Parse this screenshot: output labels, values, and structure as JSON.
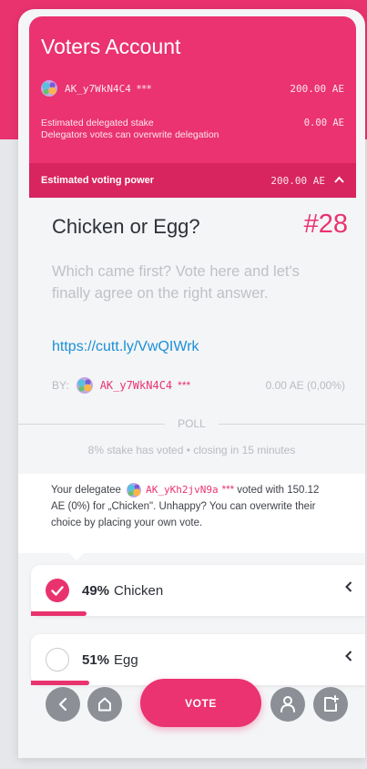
{
  "header": {
    "title": "Voters Account",
    "address": "AK_y7WkN4C4",
    "address_suffix": "***",
    "balance": "200.00 AE",
    "estimated_label_line1": "Estimated delegated stake",
    "estimated_label_line2": "Delegators votes can overwrite delegation",
    "estimated_amount": "0.00 AE",
    "power_label": "Estimated voting power",
    "power_amount": "200.00 AE"
  },
  "poll": {
    "title": "Chicken or Egg?",
    "id": "#28",
    "description": "Which came first? Vote here and let's finally agree on the right answer.",
    "link": "https://cutt.ly/VwQIWrk",
    "by_label": "BY:",
    "author": "AK_y7WkN4C4",
    "author_suffix": "***",
    "author_stake": "0.00 AE (0,00%)",
    "section_label": "POLL",
    "status": "8% stake has voted • closing in 15 minutes"
  },
  "delegate": {
    "prefix": "Your delegatee",
    "address": "AK_yKh2jvN9a",
    "address_suffix": "***",
    "voted_with": "voted with",
    "rest": "150.12 AE (0%) for „Chicken\". Unhappy? You can overwrite their choice by placing your own vote."
  },
  "options": [
    {
      "percent": "49%",
      "label": "Chicken",
      "selected": true,
      "share": 0.49
    },
    {
      "percent": "51%",
      "label": "Egg",
      "selected": false,
      "share": 0.51
    }
  ],
  "nav": {
    "vote_label": "VOTE"
  },
  "colors": {
    "accent": "#e9336e",
    "link": "#1b8fd6",
    "muted": "#b9bbc2"
  }
}
